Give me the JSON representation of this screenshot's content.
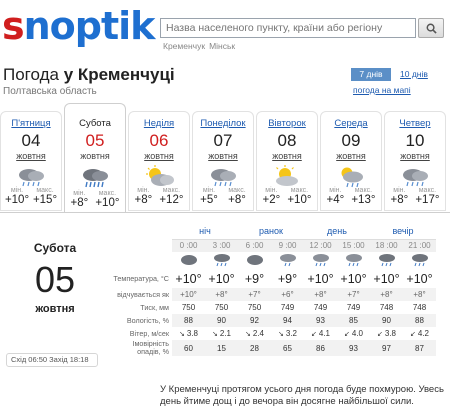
{
  "logo": {
    "part1": "s",
    "part2": "noptik"
  },
  "search": {
    "placeholder": "Назва населеного пункту, країни або регіону"
  },
  "recent_cities": [
    "Кременчук",
    "Мінськ"
  ],
  "header": {
    "title_prefix": "Погода ",
    "title_city": "у Кременчуці",
    "region": "Полтавська область"
  },
  "tabs": {
    "active": "7 днів",
    "other": "10 днів",
    "map": "погода на мапі"
  },
  "days": [
    {
      "name": "П'ятниця",
      "num": "04",
      "month": "жовтня",
      "min_lbl": "мін.",
      "max_lbl": "макс.",
      "min": "+10°",
      "max": "+15°",
      "weekend": false,
      "icon": "cloud-rain-icon"
    },
    {
      "name": "Субота",
      "num": "05",
      "month": "жовтня",
      "min_lbl": "мін.",
      "max_lbl": "макс.",
      "min": "+8°",
      "max": "+10°",
      "weekend": true,
      "icon": "cloud-rain-heavy-icon"
    },
    {
      "name": "Неділя",
      "num": "06",
      "month": "жовтня",
      "min_lbl": "мін.",
      "max_lbl": "макс.",
      "min": "+8°",
      "max": "+12°",
      "weekend": true,
      "icon": "sun-cloud-icon"
    },
    {
      "name": "Понеділок",
      "num": "07",
      "month": "жовтня",
      "min_lbl": "мін.",
      "max_lbl": "макс.",
      "min": "+5°",
      "max": "+8°",
      "weekend": false,
      "icon": "cloud-rain-icon"
    },
    {
      "name": "Вівторок",
      "num": "08",
      "month": "жовтня",
      "min_lbl": "мін.",
      "max_lbl": "макс.",
      "min": "+2°",
      "max": "+10°",
      "weekend": false,
      "icon": "sun-cloud-icon"
    },
    {
      "name": "Середа",
      "num": "09",
      "month": "жовтня",
      "min_lbl": "мін.",
      "max_lbl": "макс.",
      "min": "+4°",
      "max": "+13°",
      "weekend": false,
      "icon": "sun-cloud-rain-icon"
    },
    {
      "name": "Четвер",
      "num": "10",
      "month": "жовтня",
      "min_lbl": "мін.",
      "max_lbl": "макс.",
      "min": "+8°",
      "max": "+17°",
      "weekend": false,
      "icon": "cloud-rain-icon"
    }
  ],
  "details": {
    "weekday": "Субота",
    "num": "05",
    "month": "жовтня",
    "periods": [
      "ніч",
      "ранок",
      "день",
      "вечір"
    ],
    "hours": [
      "0 :00",
      "3 :00",
      "6 :00",
      "9 :00",
      "12 :00",
      "15 :00",
      "18 :00",
      "21 :00"
    ],
    "labels": {
      "temp": "Температура, °C",
      "feels": "відчувається як",
      "pressure": "Тиск, мм",
      "humidity": "Вологість, %",
      "wind": "Вітер, м/сек",
      "precip": "Імовірність опадів, %"
    },
    "temp": [
      "+10°",
      "+10°",
      "+9°",
      "+9°",
      "+10°",
      "+10°",
      "+10°",
      "+10°"
    ],
    "feels": [
      "+10°",
      "+8°",
      "+7°",
      "+6°",
      "+8°",
      "+7°",
      "+8°",
      "+8°"
    ],
    "pressure": [
      "750",
      "750",
      "750",
      "749",
      "749",
      "749",
      "748",
      "748"
    ],
    "humidity": [
      "88",
      "90",
      "92",
      "94",
      "93",
      "85",
      "90",
      "88"
    ],
    "wind": [
      "3.8",
      "2.1",
      "2.4",
      "3.2",
      "4.1",
      "4.0",
      "3.8",
      "4.2"
    ],
    "precip": [
      "60",
      "15",
      "28",
      "65",
      "86",
      "93",
      "97",
      "87"
    ],
    "sun": "Схід 06:50  Захід 18:18",
    "description": "У Кременчуці протягом усього дня погода буде похмурою. Увесь день йтиме дощ і до вечора він досягне найбільшої сили."
  }
}
